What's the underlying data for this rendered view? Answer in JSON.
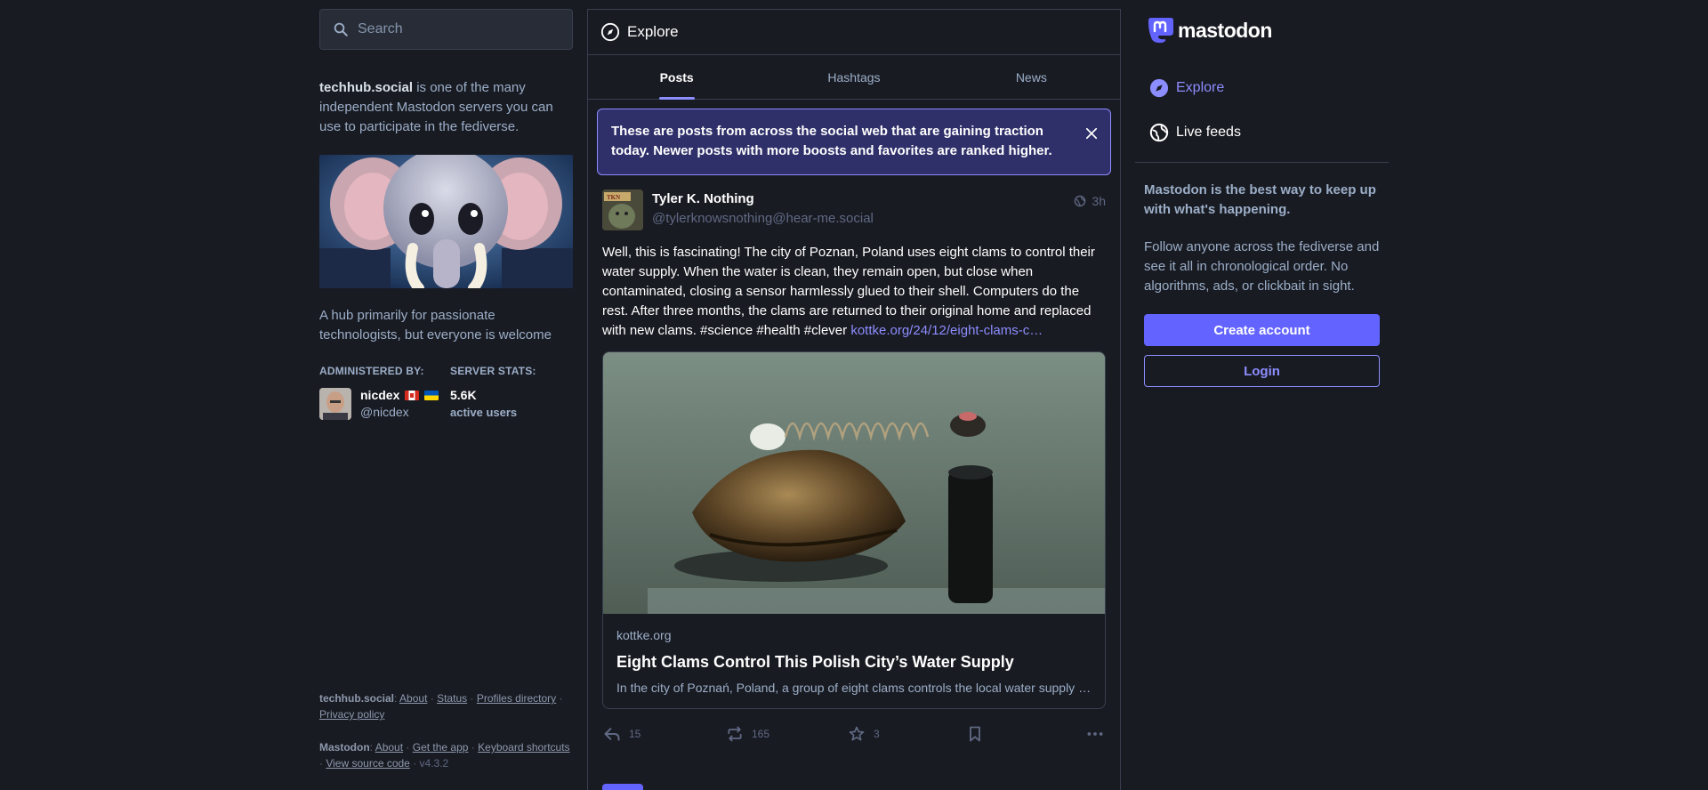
{
  "search": {
    "placeholder": "Search"
  },
  "server": {
    "name": "techhub.social",
    "about_rest": " is one of the many independent Mastodon servers you can use to participate in the fediverse.",
    "description": "A hub primarily for passionate technologists, but everyone is welcome",
    "administered_by_label": "ADMINISTERED BY:",
    "server_stats_label": "SERVER STATS:",
    "admin": {
      "name": "nicdex",
      "handle": "@nicdex"
    },
    "stats": {
      "value": "5.6K",
      "label": "active users"
    }
  },
  "footer": {
    "server_label": "techhub.social",
    "server_links": [
      "About",
      "Status",
      "Profiles directory",
      "Privacy policy"
    ],
    "mastodon_label": "Mastodon",
    "mastodon_links": [
      "About",
      "Get the app",
      "Keyboard shortcuts",
      "View source code"
    ],
    "version": "v4.3.2"
  },
  "column": {
    "title": "Explore",
    "tabs": [
      {
        "label": "Posts",
        "active": true
      },
      {
        "label": "Hashtags",
        "active": false
      },
      {
        "label": "News",
        "active": false
      }
    ],
    "notice": "These are posts from across the social web that are gaining traction today. Newer posts with more boosts and favorites are ranked higher."
  },
  "post": {
    "author": "Tyler K. Nothing",
    "handle": "@tylerknowsnothing@hear-me.social",
    "time": "3h",
    "body": "Well, this is fascinating! The city of Poznan, Poland uses eight clams to control their water supply. When the water is clean, they remain open, but close when contaminated, closing a sensor harmlessly glued to their shell. Computers do the rest. After three months, the clams are returned to their original home and replaced with new clams. #science #health #clever ",
    "link": "kottke.org/24/12/eight-clams-c…",
    "card": {
      "domain": "kottke.org",
      "title": "Eight Clams Control This Polish City’s Water Supply",
      "description": "In the city of Poznań, Poland, a group of eight clams controls the local water supply t…"
    },
    "replies": "15",
    "boosts": "165",
    "favorites": "3"
  },
  "sidebar": {
    "brand": "mastodon",
    "nav": [
      {
        "label": "Explore",
        "icon": "compass-icon",
        "active": true
      },
      {
        "label": "Live feeds",
        "icon": "globe-icon",
        "active": false
      }
    ],
    "pitch_title": "Mastodon is the best way to keep up with what's happening.",
    "pitch_body": "Follow anyone across the fediverse and see it all in chronological order. No algorithms, ads, or clickbait in sight.",
    "create_account": "Create account",
    "login": "Login"
  },
  "colors": {
    "background": "#191b22",
    "accent": "#8c8dff",
    "brand": "#6364ff",
    "border": "#393f4f",
    "muted": "#9baec8"
  }
}
